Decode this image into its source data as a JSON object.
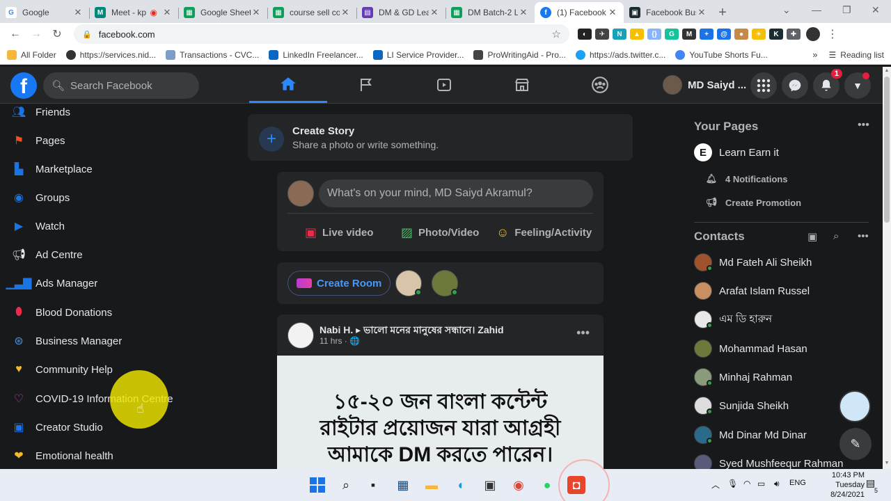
{
  "browser": {
    "tabs": [
      {
        "title": "Google",
        "color": "#ffffff",
        "glyph": "G",
        "glyph_color": "#4285f4"
      },
      {
        "title": "Meet - kp",
        "color": "#ffffff",
        "glyph": "M",
        "glyph_color": "#00897b"
      },
      {
        "title": "Google Sheets",
        "color": "#0f9d58",
        "glyph": "▦",
        "glyph_color": "#ffffff"
      },
      {
        "title": "course sell co",
        "color": "#0f9d58",
        "glyph": "▦",
        "glyph_color": "#ffffff"
      },
      {
        "title": "DM & GD Lea",
        "color": "#673ab7",
        "glyph": "▤",
        "glyph_color": "#ffffff"
      },
      {
        "title": "DM Batch-2 L",
        "color": "#0f9d58",
        "glyph": "▦",
        "glyph_color": "#ffffff"
      },
      {
        "title": "(1) Facebook",
        "color": "#1877f2",
        "glyph": "f",
        "glyph_color": "#ffffff"
      },
      {
        "title": "Facebook Bus",
        "color": "#1c2b33",
        "glyph": "▣",
        "glyph_color": "#ffffff"
      }
    ],
    "url": "facebook.com",
    "bookmarks": [
      {
        "label": "All Folder",
        "color": "#f6b73c"
      },
      {
        "label": "https://services.nid...",
        "color": "#333333"
      },
      {
        "label": "Transactions - CVC...",
        "color": "#7c9cc9"
      },
      {
        "label": "LinkedIn Freelancer...",
        "color": "#0a66c2"
      },
      {
        "label": "LI Service Provider...",
        "color": "#0a66c2"
      },
      {
        "label": "ProWritingAid - Pro...",
        "color": "#444444"
      },
      {
        "label": "https://ads.twitter.c...",
        "color": "#1da1f2"
      },
      {
        "label": "YouTube Shorts Fu...",
        "color": "#4285f4"
      }
    ],
    "bookmarks_more": "»",
    "reading_list": "Reading list"
  },
  "fb": {
    "search_placeholder": "Search Facebook",
    "user_name": "MD Saiyd ...",
    "notif_count": "1",
    "sidebar": [
      {
        "label": "Friends",
        "icon": "friends-icon",
        "color": "#1b74e4"
      },
      {
        "label": "Pages",
        "icon": "pages-icon",
        "color": "#f25022"
      },
      {
        "label": "Marketplace",
        "icon": "marketplace-icon",
        "color": "#1b74e4"
      },
      {
        "label": "Groups",
        "icon": "groups-icon",
        "color": "#1b74e4"
      },
      {
        "label": "Watch",
        "icon": "watch-icon",
        "color": "#1b74e4"
      },
      {
        "label": "Ad Centre",
        "icon": "megaphone-icon",
        "color": "#e4e6eb"
      },
      {
        "label": "Ads Manager",
        "icon": "bar-chart-icon",
        "color": "#1b74e4"
      },
      {
        "label": "Blood Donations",
        "icon": "blood-drop-icon",
        "color": "#f02849"
      },
      {
        "label": "Business Manager",
        "icon": "business-icon",
        "color": "#4e8cd6"
      },
      {
        "label": "Community Help",
        "icon": "heart-hand-icon",
        "color": "#f7b928"
      },
      {
        "label": "COVID-19 Information Centre",
        "icon": "covid-heart-icon",
        "color": "#c848c8"
      },
      {
        "label": "Creator Studio",
        "icon": "creator-studio-icon",
        "color": "#1b74e4"
      },
      {
        "label": "Emotional health",
        "icon": "emotional-health-icon",
        "color": "#f7b928"
      }
    ],
    "story": {
      "title": "Create Story",
      "subtitle": "Share a photo or write something."
    },
    "composer": {
      "placeholder": "What's on your mind, MD Saiyd Akramul?",
      "actions": [
        {
          "label": "Live video",
          "color": "#f02849"
        },
        {
          "label": "Photo/Video",
          "color": "#45bd62"
        },
        {
          "label": "Feeling/Activity",
          "color": "#f7b928"
        }
      ]
    },
    "rooms": {
      "label": "Create Room"
    },
    "post": {
      "author": "Nabi H. ▸ ভালো মনের মানুষের সন্ধানে। Zahid",
      "time": "11 hrs · 🌐",
      "image_lines": [
        "১৫-২০ জন বাংলা কন্টেন্ট",
        "রাইটার প্রয়োজন যারা আগ্রহী",
        "আমাকে DM করতে পারেন।"
      ]
    },
    "right": {
      "pages_heading": "Your Pages",
      "page_name": "Learn Earn it",
      "page_notifications": "4 Notifications",
      "page_promotion": "Create Promotion",
      "contacts_heading": "Contacts",
      "contacts": [
        {
          "name": "Md Fateh Ali Sheikh",
          "color": "#a0522d"
        },
        {
          "name": "Arafat Islam Russel",
          "color": "#c89060"
        },
        {
          "name": "এম ডি হারুন",
          "color": "#e8e8e8"
        },
        {
          "name": "Mohammad Hasan",
          "color": "#6b7a3a"
        },
        {
          "name": "Minhaj Rahman",
          "color": "#8a9a7a"
        },
        {
          "name": "Sunjida Sheikh",
          "color": "#dddddd"
        },
        {
          "name": "Md Dinar Md Dinar",
          "color": "#2a6a8a"
        },
        {
          "name": "Syed Mushfeequr Rahman",
          "color": "#5a5a7a"
        }
      ]
    }
  },
  "taskbar": {
    "lang": "ENG",
    "time": "10:43 PM",
    "day": "Tuesday",
    "date": "8/24/2021",
    "action_badge": "5"
  }
}
